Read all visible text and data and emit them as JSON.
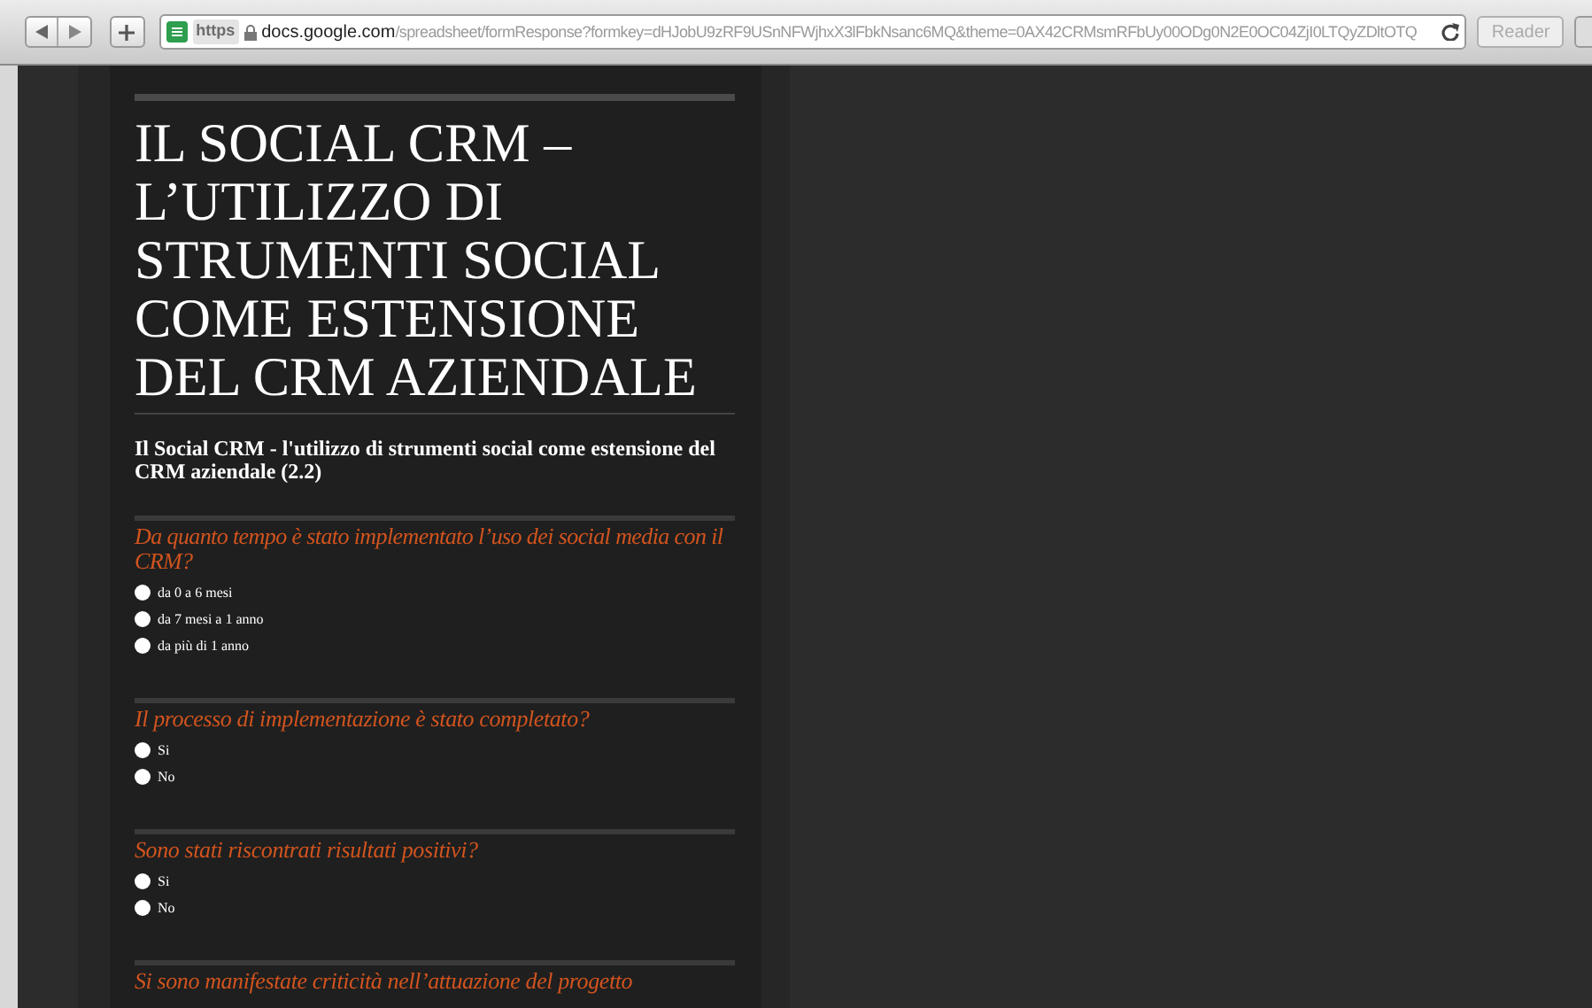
{
  "browser": {
    "url_scheme": "https",
    "url_host": "docs.google.com",
    "url_path": "/spreadsheet/formResponse?formkey=dHJobU9zRF9USnNFWjhxX3lFbkNsanc6MQ&theme=0AX42CRMsmRFbUy00ODg0N2E0OC04ZjI0LTQyZDltOTQ",
    "reader_button": "Reader"
  },
  "form": {
    "title": "IL SOCIAL CRM – L’UTILIZZO DI STRUMENTI SOCIAL COME ESTENSIONE DEL CRM AZIENDALE",
    "description": "Il Social CRM - l'utilizzo di strumenti social come estensione del CRM aziendale (2.2)",
    "questions": [
      {
        "text": "Da quanto tempo è stato implementato l’uso dei social media con il CRM?",
        "options": [
          {
            "label": "da 0 a 6 mesi",
            "selected": false
          },
          {
            "label": "da 7 mesi a 1 anno",
            "selected": false
          },
          {
            "label": "da più di 1 anno",
            "selected": false
          }
        ]
      },
      {
        "text": "Il processo di implementazione è stato completato?",
        "options": [
          {
            "label": "Si",
            "selected": false
          },
          {
            "label": "No",
            "selected": false
          }
        ]
      },
      {
        "text": "Sono stati riscontrati risultati positivi?",
        "options": [
          {
            "label": "Si",
            "selected": false
          },
          {
            "label": "No",
            "selected": false
          }
        ]
      },
      {
        "text": "Si sono manifestate criticità nell’attuazione del progetto"
      }
    ]
  }
}
